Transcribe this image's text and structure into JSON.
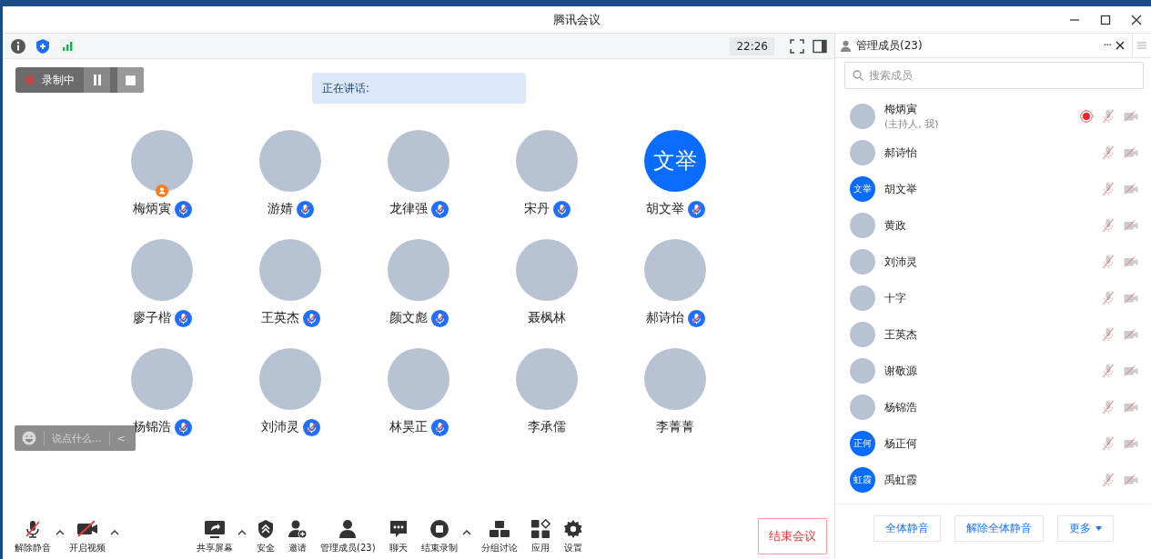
{
  "window": {
    "title": "腾讯会议"
  },
  "top_bar": {
    "time": "22:26"
  },
  "recording": {
    "label": "录制中"
  },
  "speaking": {
    "label": "正在讲话:"
  },
  "participants": [
    {
      "name": "梅炳寅",
      "kind": "photo",
      "host": true,
      "muted": true
    },
    {
      "name": "游婧",
      "kind": "photo",
      "host": false,
      "muted": true
    },
    {
      "name": "龙律强",
      "kind": "photo",
      "host": false,
      "muted": true
    },
    {
      "name": "宋丹",
      "kind": "photo",
      "host": false,
      "muted": true
    },
    {
      "name": "胡文举",
      "kind": "initials",
      "initials": "文举",
      "host": false,
      "muted": true
    },
    {
      "name": "廖子楷",
      "kind": "photo",
      "host": false,
      "muted": true
    },
    {
      "name": "王英杰",
      "kind": "photo",
      "host": false,
      "muted": true
    },
    {
      "name": "颜文彪",
      "kind": "photo",
      "host": false,
      "muted": true
    },
    {
      "name": "聂枫林",
      "kind": "photo",
      "host": false,
      "muted": false
    },
    {
      "name": "郝诗怡",
      "kind": "photo",
      "host": false,
      "muted": true
    },
    {
      "name": "杨锦浩",
      "kind": "photo",
      "host": false,
      "muted": true
    },
    {
      "name": "刘沛灵",
      "kind": "photo",
      "host": false,
      "muted": true
    },
    {
      "name": "林昊正",
      "kind": "photo",
      "host": false,
      "muted": true
    },
    {
      "name": "李承儒",
      "kind": "photo",
      "host": false,
      "muted": false
    },
    {
      "name": "李菁菁",
      "kind": "photo",
      "host": false,
      "muted": false
    }
  ],
  "chat_box": {
    "placeholder": "说点什么...",
    "collapse": "<"
  },
  "toolbar_left": [
    {
      "label": "解除静音",
      "kind": "mic-off",
      "has_menu": true
    },
    {
      "label": "开启视频",
      "kind": "video-off",
      "has_menu": true
    }
  ],
  "toolbar_center": [
    {
      "label": "共享屏幕",
      "kind": "share",
      "has_menu": true
    },
    {
      "label": "安全",
      "kind": "shield",
      "has_menu": false
    },
    {
      "label": "邀请",
      "kind": "invite",
      "has_menu": false
    },
    {
      "label": "管理成员(23)",
      "kind": "members",
      "has_menu": false
    },
    {
      "label": "聊天",
      "kind": "chat",
      "has_menu": false
    },
    {
      "label": "结束录制",
      "kind": "stop",
      "has_menu": true
    },
    {
      "label": "分组讨论",
      "kind": "breakout",
      "has_menu": false
    },
    {
      "label": "应用",
      "kind": "apps",
      "has_menu": false
    },
    {
      "label": "设置",
      "kind": "settings",
      "has_menu": false
    }
  ],
  "end_button": "结束会议",
  "panel": {
    "title": "管理成员(23)",
    "more": "···",
    "search_placeholder": "搜索成员",
    "members": [
      {
        "name": "梅炳寅",
        "note": "(主持人, 我)",
        "kind": "photo",
        "recording": true
      },
      {
        "name": "郝诗怡",
        "kind": "photo",
        "recording": false
      },
      {
        "name": "胡文举",
        "kind": "initials",
        "initials": "文举",
        "recording": false
      },
      {
        "name": "黄政",
        "kind": "photo",
        "recording": false
      },
      {
        "name": "刘沛灵",
        "kind": "photo",
        "recording": false
      },
      {
        "name": "十字",
        "kind": "photo",
        "recording": false
      },
      {
        "name": "王英杰",
        "kind": "photo",
        "recording": false
      },
      {
        "name": "谢敬源",
        "kind": "photo",
        "recording": false
      },
      {
        "name": "杨锦浩",
        "kind": "photo",
        "recording": false
      },
      {
        "name": "杨正何",
        "kind": "initials",
        "initials": "正何",
        "recording": false
      },
      {
        "name": "禹虹霞",
        "kind": "initials",
        "initials": "虹霞",
        "recording": false
      }
    ],
    "buttons": [
      "全体静音",
      "解除全体静音",
      "更多"
    ]
  }
}
